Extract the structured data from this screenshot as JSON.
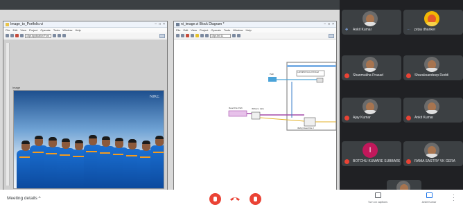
{
  "window1": {
    "title": "Image_to_Portfolio.vi",
    "menu": [
      "File",
      "Edit",
      "View",
      "Project",
      "Operate",
      "Tools",
      "Window",
      "Help"
    ],
    "font_select": "15pt Application Font",
    "image_label": "Image",
    "photo_brand": "NIKE"
  },
  "window2": {
    "title": "ni_image.vi Block Diagram *",
    "menu": [
      "File",
      "Edit",
      "View",
      "Project",
      "Operate",
      "Tools",
      "Window",
      "Help"
    ],
    "font_select": "15pt Aril 11",
    "nodes": {
      "path_label": "Path",
      "read_file_label": "Read File Path",
      "image_data_label": "IMAQ to data",
      "loop_label": "LabVIEW.Picture.FIF.Read",
      "write_label": "IMAQ Read File 2"
    }
  },
  "participants": [
    {
      "name": "Ankit Kumar",
      "muted": false,
      "pinned": true
    },
    {
      "name": "priya dhanker",
      "muted": false,
      "pinned": false
    },
    {
      "name": "Shanmukha Prasad",
      "muted": true
    },
    {
      "name": "Sharaksandeep Reddi",
      "muted": true
    },
    {
      "name": "Ajay Kumar",
      "muted": true
    },
    {
      "name": "Ankit Kumar",
      "muted": true
    },
    {
      "name": "BOTCHU KUMARE SUBBAREDDI",
      "muted": true,
      "initial": "I"
    },
    {
      "name": "RAMA SASTRY VK GERA",
      "muted": true
    }
  ],
  "bottom": {
    "meeting_details": "Meeting details ^",
    "turn_on_captions": "Turn on captions",
    "present": "Ankit Kumar"
  },
  "colors": {
    "accent_red": "#ea4335",
    "bg_dark": "#202124",
    "tile": "#3c4043"
  }
}
